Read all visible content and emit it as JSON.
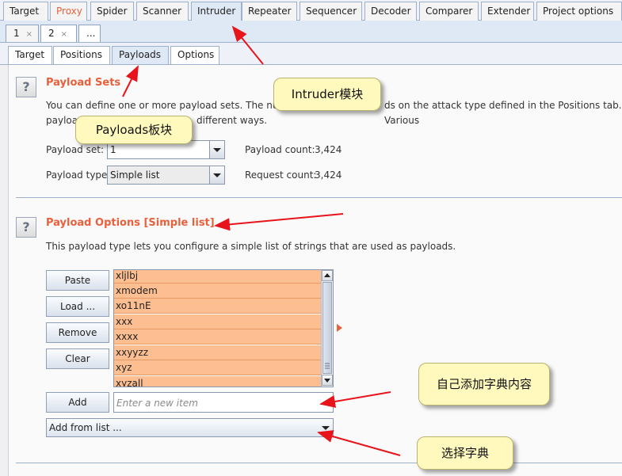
{
  "main_tabs": [
    "Target",
    "Proxy",
    "Spider",
    "Scanner",
    "Intruder",
    "Repeater",
    "Sequencer",
    "Decoder",
    "Comparer",
    "Extender",
    "Project options"
  ],
  "sub_tabs": {
    "tab1": "1",
    "tab2": "2",
    "close": "×",
    "more": "..."
  },
  "config_tabs": [
    "Target",
    "Positions",
    "Payloads",
    "Options"
  ],
  "payload_sets": {
    "title": "Payload Sets",
    "description_line1": "You can define one or more payload sets. The numb",
    "description_line1_tail": "ds on the attack type defined in the Positions tab. Various",
    "description_line2_head": "payloa",
    "description_line2_tail": "different ways.",
    "payload_set_label": "Payload set:",
    "payload_set_value": "1",
    "payload_type_label": "Payload type:",
    "payload_type_value": "Simple list",
    "payload_count_label": "Payload count:",
    "payload_count": "3,424",
    "request_count_label": "Request count:",
    "request_count": "3,424"
  },
  "payload_options": {
    "title": "Payload Options [Simple list]",
    "description": "This payload type lets you configure a simple list of strings that are used as payloads.",
    "buttons": {
      "paste": "Paste",
      "load": "Load ...",
      "remove": "Remove",
      "clear": "Clear",
      "add": "Add"
    },
    "items": [
      "xljlbj",
      "xmodem",
      "xo11nE",
      "xxx",
      "xxxx",
      "xxyyzz",
      "xyz",
      "xyzall"
    ],
    "new_item_placeholder": "Enter a new item",
    "add_from_list": "Add from list ..."
  },
  "callouts": {
    "intruder": "Intruder模块",
    "payloads": "Payloads板块",
    "add_dict": "自己添加字典内容",
    "select_dict": "选择字典"
  },
  "colors": {
    "accent_orange": "#e8603c",
    "list_item_bg": "#fdbf92",
    "arrow_red": "#e8141b",
    "callout_bg": "#fff9be"
  }
}
